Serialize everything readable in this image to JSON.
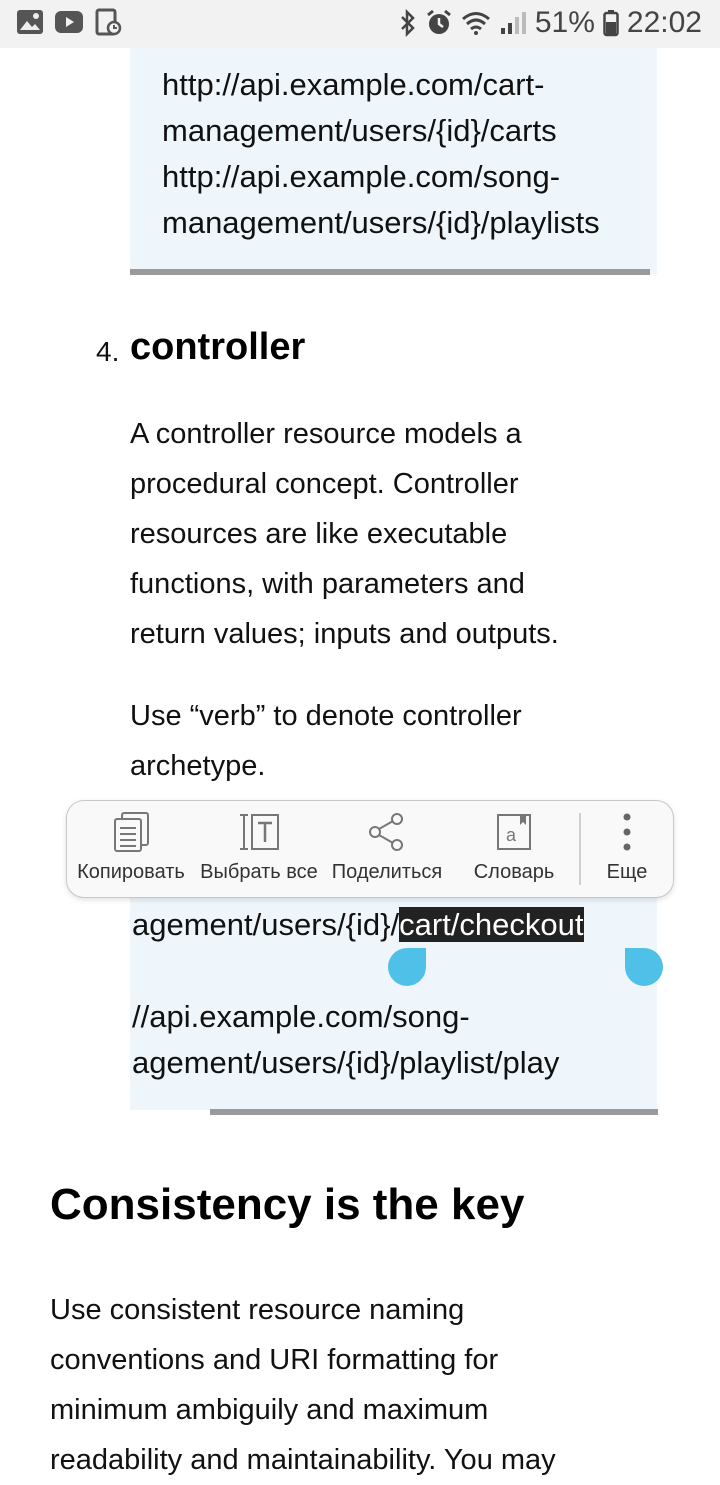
{
  "status_bar": {
    "battery_percent": "51%",
    "time": "22:02",
    "icons": [
      "image-icon",
      "youtube-icon",
      "clipboard-icon",
      "bluetooth-icon",
      "alarm-icon",
      "wifi-icon",
      "signal-icon",
      "battery-icon"
    ]
  },
  "code_block_1": {
    "lines": [
      "http://api.example.com/cart-",
      "management/users/{id}/carts",
      "http://api.example.com/song-",
      "management/users/{id}/playlists"
    ]
  },
  "section_controller": {
    "number": "4.",
    "title": "controller",
    "paragraph_lines": [
      "A controller resource models a",
      "procedural concept. Controller",
      "resources are like executable",
      "functions, with parameters and",
      "return values; inputs and outputs."
    ],
    "verb_lines": [
      "Use “verb” to denote controller",
      "archetype."
    ]
  },
  "context_menu": {
    "items": [
      {
        "label": "Копировать",
        "icon": "copy-icon"
      },
      {
        "label": "Выбрать все",
        "icon": "select-all-icon"
      },
      {
        "label": "Поделиться",
        "icon": "share-icon"
      },
      {
        "label": "Словарь",
        "icon": "dictionary-icon"
      },
      {
        "label": "Еще",
        "icon": "more-vert-icon"
      }
    ]
  },
  "code_block_2": {
    "line1_prefix": "agement/users/{id}/",
    "line1_selected": "cart/checkout",
    "line2": "//api.example.com/song-",
    "line3": "agement/users/{id}/playlist/play"
  },
  "section_consistency": {
    "title": "Consistency is the key",
    "paragraph_lines": [
      "Use consistent resource naming",
      "conventions and URI formatting for",
      "minimum ambiguily and maximum",
      "readability and maintainability. You may"
    ]
  },
  "colors": {
    "selection_handle": "#4fc0e8",
    "code_background": "#eef6fb",
    "selection_background": "#222222"
  }
}
